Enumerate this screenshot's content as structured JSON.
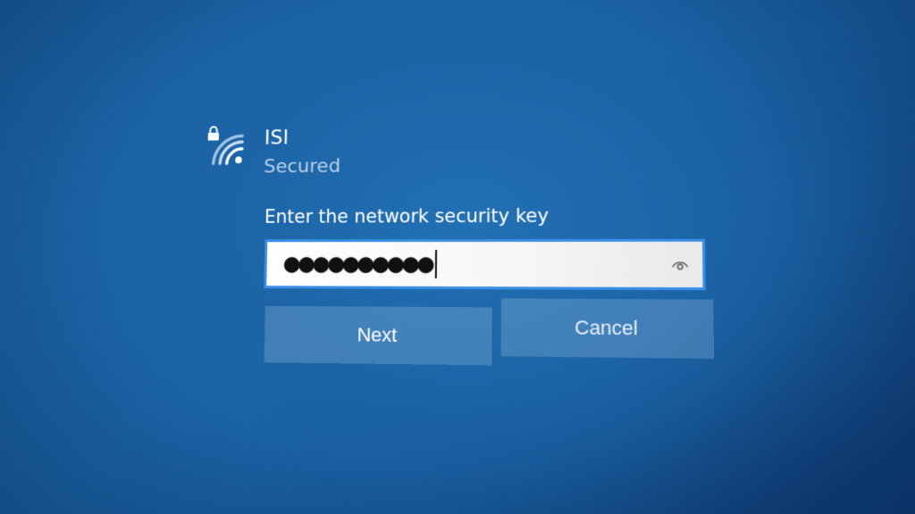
{
  "network": {
    "ssid": "ISI",
    "status": "Secured",
    "icons": {
      "signal": "wifi-signal-icon",
      "lock": "lock-icon"
    }
  },
  "security_key": {
    "prompt": "Enter the network security key",
    "value_masked": "●●●●●●●●●●",
    "reveal_icon": "eye-icon"
  },
  "buttons": {
    "next": "Next",
    "cancel": "Cancel"
  },
  "colors": {
    "background": "#1b64a6",
    "field_border": "#3a8ee6",
    "button_fill": "#5f8fc0"
  }
}
